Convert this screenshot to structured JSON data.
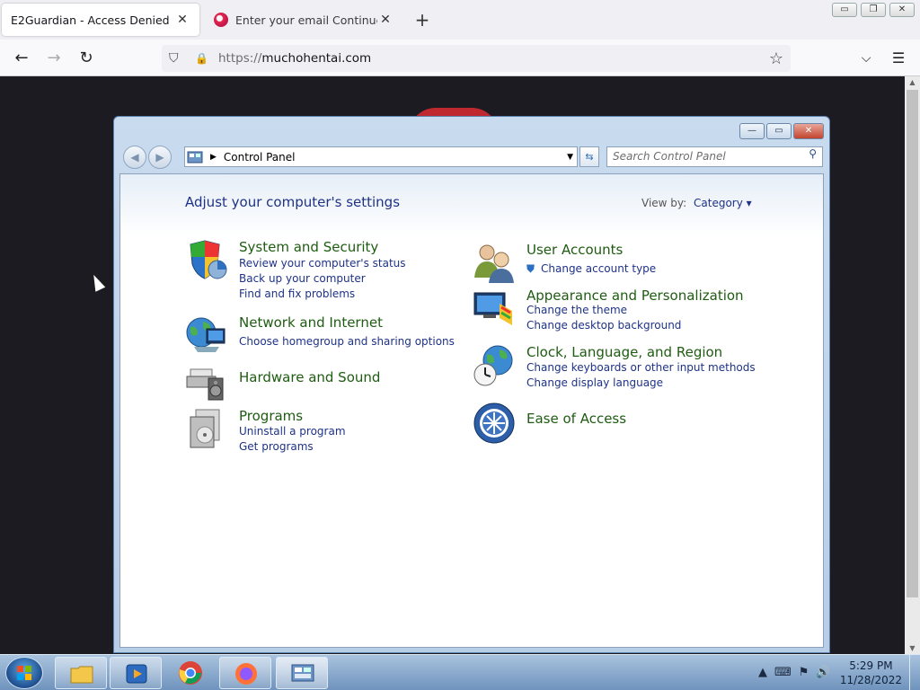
{
  "browser": {
    "tabs": [
      {
        "label": "E2Guardian - Access Denied",
        "active": true
      },
      {
        "label": "Enter your email Continue to Pr",
        "active": false
      }
    ],
    "url_scheme": "https://",
    "url_host": "muchohentai.com",
    "window_controls": {
      "minimize": "▭",
      "restore": "❐",
      "close": "✕"
    },
    "nav": {
      "back": "←",
      "forward": "→",
      "reload": "↻",
      "new_tab": "+"
    },
    "icons": {
      "shield": "⛉",
      "lock": "🔒",
      "star": "☆",
      "pocket": "⌵",
      "menu": "☰"
    }
  },
  "control_panel": {
    "address_label": "Control Panel",
    "search_placeholder": "Search Control Panel",
    "heading": "Adjust your computer's settings",
    "view_by_label": "View by:",
    "view_by_value": "Category ▾",
    "categories_left": [
      {
        "title": "System and Security",
        "links": [
          "Review your computer's status",
          "Back up your computer",
          "Find and fix problems"
        ],
        "icon": "shield-icon"
      },
      {
        "title": "Network and Internet",
        "links": [
          "Choose homegroup and sharing options"
        ],
        "icon": "network-globe-icon"
      },
      {
        "title": "Hardware and Sound",
        "links": [],
        "icon": "printer-speaker-icon"
      },
      {
        "title": "Programs",
        "links": [
          "Uninstall a program",
          "Get programs"
        ],
        "icon": "programs-icon"
      }
    ],
    "categories_right": [
      {
        "title": "User Accounts",
        "links": [
          "Change account type"
        ],
        "icon": "users-icon"
      },
      {
        "title": "Appearance and Personalization",
        "links": [
          "Change the theme",
          "Change desktop background"
        ],
        "icon": "monitor-palette-icon"
      },
      {
        "title": "Clock, Language, and Region",
        "links": [
          "Change keyboards or other input methods",
          "Change display language"
        ],
        "icon": "globe-clock-icon"
      },
      {
        "title": "Ease of Access",
        "links": [],
        "icon": "ease-of-access-icon"
      }
    ]
  },
  "taskbar": {
    "time": "5:29 PM",
    "date": "11/28/2022",
    "apps": [
      "file-explorer",
      "media-player",
      "chrome",
      "firefox",
      "control-panel"
    ],
    "tray_icons": [
      "▲",
      "⌨",
      "⚑",
      "🔊"
    ]
  },
  "colors": {
    "category_title": "#1e5c11",
    "link": "#1e3287",
    "heading": "#1e3287"
  }
}
